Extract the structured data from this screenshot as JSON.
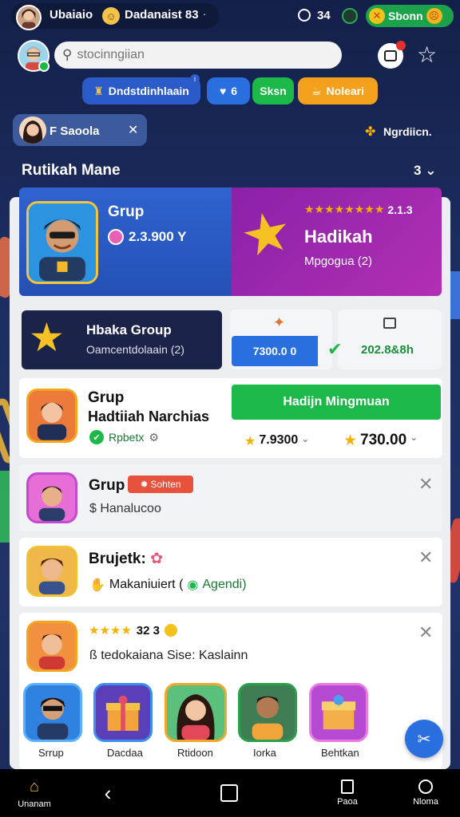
{
  "status": {
    "user_name": "Ubaiaio",
    "group_name": "Dadanaist 83",
    "time": "34",
    "right_label": "Sbonn"
  },
  "search": {
    "placeholder": "stocinngiian"
  },
  "badges": {
    "primary": "Dndstdinhlaain",
    "count": "6",
    "green": "Sksn",
    "orange": "Noleari"
  },
  "chip": {
    "name": "Saoola",
    "location": "Ngrdiicn."
  },
  "section": {
    "title": "Rutikah Mane",
    "count": "3"
  },
  "hero": {
    "left_title": "Grup",
    "left_value": "2.3.900 Y",
    "right_rating": "2.1.3",
    "right_title": "Hadikah",
    "right_sub": "Mpgogua (2)"
  },
  "row2": {
    "title": "Hbaka Group",
    "sub": "Oamcentdolaain (2)",
    "amount": "7300.0 0",
    "amount2": "202.8&8h"
  },
  "group_card": {
    "title": "Grup",
    "subtitle": "Hadtiiah Narchias",
    "tag": "Rpbetx",
    "button": "Hadijn Mingmuan",
    "price1": "7.9300",
    "price2": "730.00"
  },
  "items": [
    {
      "title": "Grup",
      "tag": "Sohten",
      "sub": "Hanalucoo"
    },
    {
      "title": "Brujetk:",
      "sub": "Makaniuiert (",
      "sub2": "Agendi)"
    },
    {
      "rating": "32 3",
      "sub": "tedokaiana Sise: Kaslainn"
    }
  ],
  "thumbs": [
    "Srrup",
    "Dacdaa",
    "Rtidoon",
    "Iorka",
    "Behtkan"
  ],
  "nav": {
    "home": "Unanam",
    "doc": "Paoa",
    "more": "Nloma"
  },
  "colors": {
    "blue": "#2a5bc9",
    "purple": "#8b1fa3",
    "green": "#1db84a",
    "orange": "#f3a11d"
  }
}
